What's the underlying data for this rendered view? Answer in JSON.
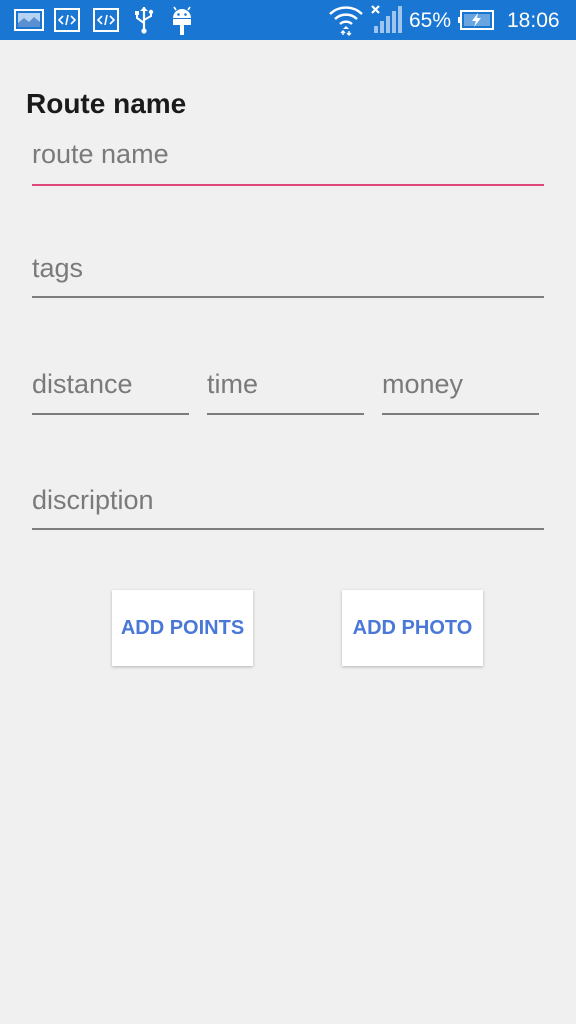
{
  "status_bar": {
    "battery_percent": "65%",
    "time": "18:06",
    "icons": [
      "gallery-icon",
      "code-icon",
      "code-icon",
      "usb-icon",
      "android-icon",
      "wifi-icon",
      "signal-icon",
      "battery-charging-icon"
    ]
  },
  "form": {
    "title": "Route name",
    "route_name_placeholder": "route name",
    "tags_placeholder": "tags",
    "distance_placeholder": "distance",
    "time_placeholder": "time",
    "money_placeholder": "money",
    "description_placeholder": "discription"
  },
  "buttons": {
    "add_points": "ADD POINTS",
    "add_photo": "ADD PHOTO"
  },
  "colors": {
    "status_bar": "#1976d2",
    "accent_underline": "#e0457b",
    "button_text": "#4a78d8",
    "background": "#f0f0f0"
  }
}
